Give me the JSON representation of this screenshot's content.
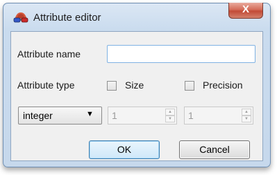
{
  "window": {
    "title": "Attribute editor",
    "close_label": "X",
    "icon": "3d-glasses-icon"
  },
  "form": {
    "name_label": "Attribute name",
    "name_value": "",
    "type_label": "Attribute type",
    "size_label": "Size",
    "size_checked": false,
    "precision_label": "Precision",
    "precision_checked": false,
    "type_value": "integer",
    "size_value": "1",
    "precision_value": "1"
  },
  "buttons": {
    "ok": "OK",
    "cancel": "Cancel"
  }
}
